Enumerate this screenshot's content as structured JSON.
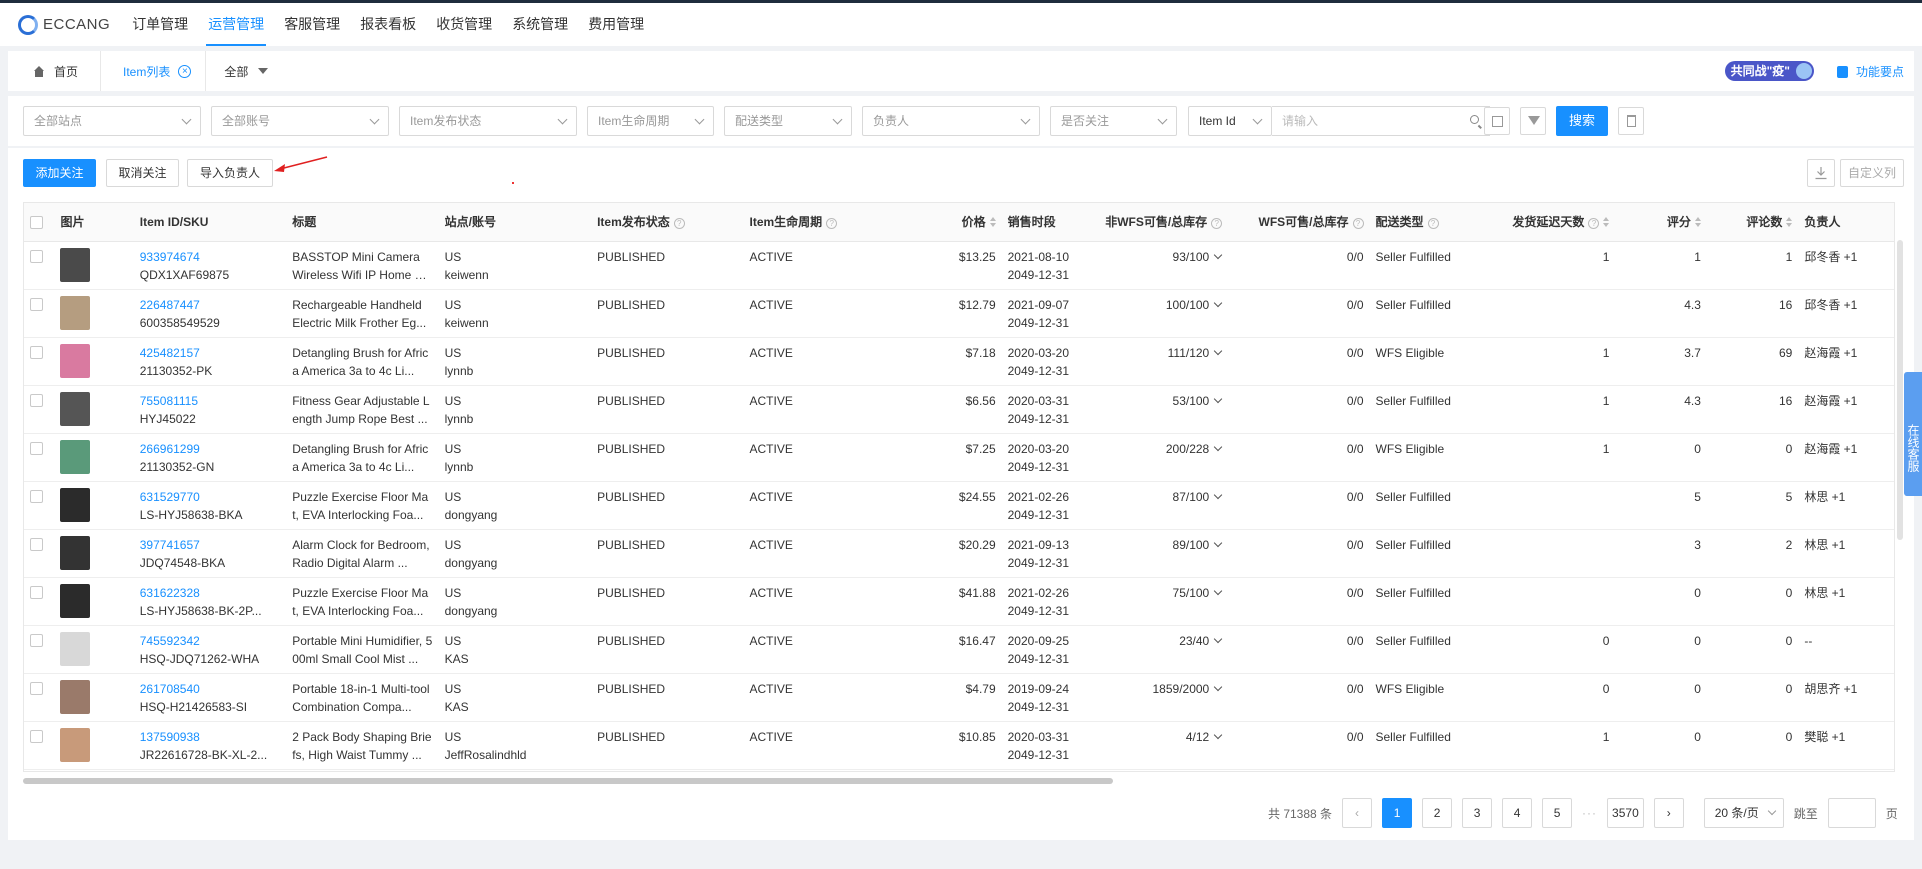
{
  "app": {
    "logo": "ECCANG"
  },
  "nav": {
    "items": [
      "订单管理",
      "运营管理",
      "客服管理",
      "报表看板",
      "收货管理",
      "系统管理",
      "费用管理"
    ],
    "active_index": 1
  },
  "tabs": {
    "home": "首页",
    "item_list": "Item列表",
    "all": "全部"
  },
  "banner": {
    "fight": "共同战\"疫\"",
    "feature_point": "功能要点"
  },
  "filters": {
    "site": "全部站点",
    "account": "全部账号",
    "publish_status": "Item发布状态",
    "lifecycle": "Item生命周期",
    "delivery_type": "配送类型",
    "owner": "负责人",
    "followed": "是否关注",
    "id_type": "Item Id",
    "search_placeholder": "请输入",
    "search_button": "搜索"
  },
  "actions": {
    "add_follow": "添加关注",
    "cancel_follow": "取消关注",
    "import_owner": "导入负责人",
    "custom_columns": "自定义列"
  },
  "table": {
    "headers": [
      "图片",
      "Item ID/SKU",
      "标题",
      "站点/账号",
      "Item发布状态",
      "Item生命周期",
      "价格",
      "销售时段",
      "非WFS可售/总库存",
      "WFS可售/总库存",
      "配送类型",
      "发货延迟天数",
      "评分",
      "评论数",
      "负责人"
    ],
    "rows": [
      {
        "id": "933974674",
        "sku": "QDX1XAF69875",
        "title": "BASSTOP Mini Camera Wireless Wifi IP Home Se...",
        "site": "US",
        "account": "keiwenn",
        "status": "PUBLISHED",
        "lifecycle": "ACTIVE",
        "price": "$13.25",
        "start": "2021-08-10",
        "end": "2049-12-31",
        "nonwfs": "93/100",
        "wfs": "0/0",
        "delivery": "Seller Fulfilled",
        "delay": "1",
        "rating": "1",
        "reviews": "1",
        "owner": "邱冬香 +1",
        "thumb": "#4a4a4a"
      },
      {
        "id": "226487447",
        "sku": "600358549529",
        "title": "Rechargeable Handheld Electric Milk Frother Eg...",
        "site": "US",
        "account": "keiwenn",
        "status": "PUBLISHED",
        "lifecycle": "ACTIVE",
        "price": "$12.79",
        "start": "2021-09-07",
        "end": "2049-12-31",
        "nonwfs": "100/100",
        "wfs": "0/0",
        "delivery": "Seller Fulfilled",
        "delay": "",
        "rating": "4.3",
        "reviews": "16",
        "owner": "邱冬香 +1",
        "thumb": "#b59d80"
      },
      {
        "id": "425482157",
        "sku": "21130352-PK",
        "title": "Detangling Brush for Africa America 3a to 4c Li...",
        "site": "US",
        "account": "lynnb",
        "status": "PUBLISHED",
        "lifecycle": "ACTIVE",
        "price": "$7.18",
        "start": "2020-03-20",
        "end": "2049-12-31",
        "nonwfs": "111/120",
        "wfs": "0/0",
        "delivery": "WFS Eligible",
        "delay": "1",
        "rating": "3.7",
        "reviews": "69",
        "owner": "赵海霞 +1",
        "thumb": "#d97aa0"
      },
      {
        "id": "755081115",
        "sku": "HYJ45022",
        "title": "Fitness Gear Adjustable Length Jump Rope Best ...",
        "site": "US",
        "account": "lynnb",
        "status": "PUBLISHED",
        "lifecycle": "ACTIVE",
        "price": "$6.56",
        "start": "2020-03-31",
        "end": "2049-12-31",
        "nonwfs": "53/100",
        "wfs": "0/0",
        "delivery": "Seller Fulfilled",
        "delay": "1",
        "rating": "4.3",
        "reviews": "16",
        "owner": "赵海霞 +1",
        "thumb": "#555555"
      },
      {
        "id": "266961299",
        "sku": "21130352-GN",
        "title": "Detangling Brush for Africa America 3a to 4c Li...",
        "site": "US",
        "account": "lynnb",
        "status": "PUBLISHED",
        "lifecycle": "ACTIVE",
        "price": "$7.25",
        "start": "2020-03-20",
        "end": "2049-12-31",
        "nonwfs": "200/228",
        "wfs": "0/0",
        "delivery": "WFS Eligible",
        "delay": "1",
        "rating": "0",
        "reviews": "0",
        "owner": "赵海霞 +1",
        "thumb": "#5a9a7a"
      },
      {
        "id": "631529770",
        "sku": "LS-HYJ58638-BKA",
        "title": "Puzzle Exercise Floor Mat, EVA Interlocking Foa...",
        "site": "US",
        "account": "dongyang",
        "status": "PUBLISHED",
        "lifecycle": "ACTIVE",
        "price": "$24.55",
        "start": "2021-02-26",
        "end": "2049-12-31",
        "nonwfs": "87/100",
        "wfs": "0/0",
        "delivery": "Seller Fulfilled",
        "delay": "",
        "rating": "5",
        "reviews": "5",
        "owner": "林思 +1",
        "thumb": "#2b2b2b"
      },
      {
        "id": "397741657",
        "sku": "JDQ74548-BKA",
        "title": "Alarm Clock for Bedroom, Radio Digital Alarm ...",
        "site": "US",
        "account": "dongyang",
        "status": "PUBLISHED",
        "lifecycle": "ACTIVE",
        "price": "$20.29",
        "start": "2021-09-13",
        "end": "2049-12-31",
        "nonwfs": "89/100",
        "wfs": "0/0",
        "delivery": "Seller Fulfilled",
        "delay": "",
        "rating": "3",
        "reviews": "2",
        "owner": "林思 +1",
        "thumb": "#333333"
      },
      {
        "id": "631622328",
        "sku": "LS-HYJ58638-BK-2P...",
        "title": "Puzzle Exercise Floor Mat, EVA Interlocking Foa...",
        "site": "US",
        "account": "dongyang",
        "status": "PUBLISHED",
        "lifecycle": "ACTIVE",
        "price": "$41.88",
        "start": "2021-02-26",
        "end": "2049-12-31",
        "nonwfs": "75/100",
        "wfs": "0/0",
        "delivery": "Seller Fulfilled",
        "delay": "",
        "rating": "0",
        "reviews": "0",
        "owner": "林思 +1",
        "thumb": "#2b2b2b"
      },
      {
        "id": "745592342",
        "sku": "HSQ-JDQ71262-WHA",
        "title": "Portable Mini Humidifier, 500ml Small Cool Mist ...",
        "site": "US",
        "account": "KAS",
        "status": "PUBLISHED",
        "lifecycle": "ACTIVE",
        "price": "$16.47",
        "start": "2020-09-25",
        "end": "2049-12-31",
        "nonwfs": "23/40",
        "wfs": "0/0",
        "delivery": "Seller Fulfilled",
        "delay": "0",
        "rating": "0",
        "reviews": "0",
        "owner": "--",
        "thumb": "#d8d8d8"
      },
      {
        "id": "261708540",
        "sku": "HSQ-H21426583-SI",
        "title": "Portable 18-in-1 Multi-tool Combination Compa...",
        "site": "US",
        "account": "KAS",
        "status": "PUBLISHED",
        "lifecycle": "ACTIVE",
        "price": "$4.79",
        "start": "2019-09-24",
        "end": "2049-12-31",
        "nonwfs": "1859/2000",
        "wfs": "0/0",
        "delivery": "WFS Eligible",
        "delay": "0",
        "rating": "0",
        "reviews": "0",
        "owner": "胡思齐 +1",
        "thumb": "#9a7a6a"
      },
      {
        "id": "137590938",
        "sku": "JR22616728-BK-XL-2...",
        "title": "2 Pack Body Shaping Briefs, High Waist Tummy ...",
        "site": "US",
        "account": "JeffRosalindhld",
        "status": "PUBLISHED",
        "lifecycle": "ACTIVE",
        "price": "$10.85",
        "start": "2020-03-31",
        "end": "2049-12-31",
        "nonwfs": "4/12",
        "wfs": "0/0",
        "delivery": "Seller Fulfilled",
        "delay": "1",
        "rating": "0",
        "reviews": "0",
        "owner": "樊聪 +1",
        "thumb": "#c89a7a"
      }
    ]
  },
  "pagination": {
    "total": "共 71388 条",
    "pages": [
      "1",
      "2",
      "3",
      "4",
      "5"
    ],
    "last": "3570",
    "ellipsis": "···",
    "page_size": "20 条/页",
    "jump_to": "跳至",
    "page_unit": "页"
  },
  "side_tab": "在线客服",
  "colors": {
    "primary": "#1890ff",
    "annotation_arrow": "#e02020"
  }
}
